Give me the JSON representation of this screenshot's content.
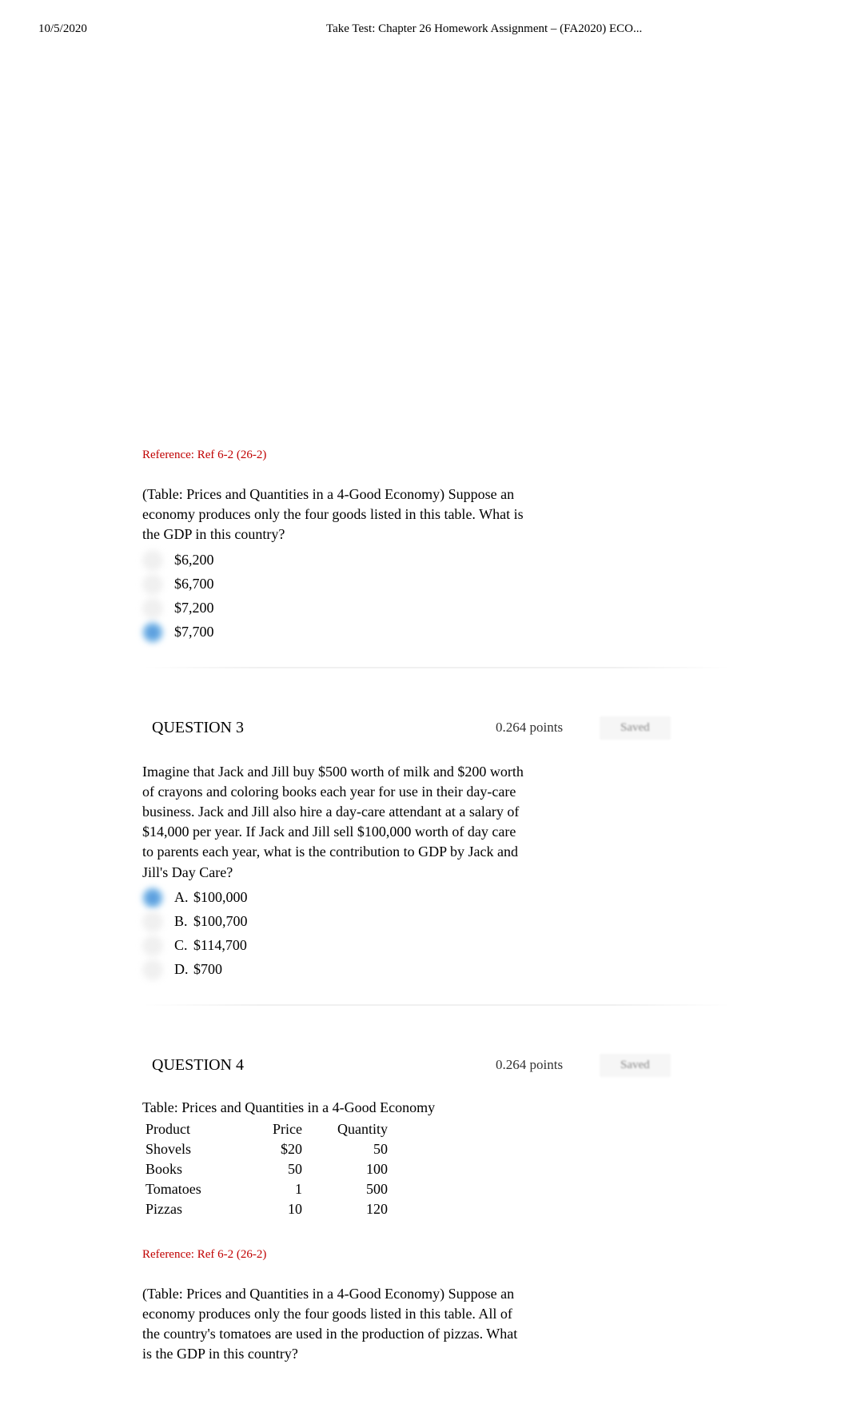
{
  "header": {
    "date": "10/5/2020",
    "title": "Take Test: Chapter 26 Homework Assignment – (FA2020) ECO..."
  },
  "question2_partial": {
    "reference": "Reference: Ref 6-2 (26-2)",
    "text": "(Table: Prices and Quantities in a 4-Good Economy) Suppose an economy produces only the four goods listed in this table. What is the GDP in this country?",
    "options": [
      {
        "label": "$6,200",
        "selected": false
      },
      {
        "label": "$6,700",
        "selected": false
      },
      {
        "label": "$7,200",
        "selected": false
      },
      {
        "label": "$7,700",
        "selected": true
      }
    ]
  },
  "question3": {
    "title": "QUESTION 3",
    "points": "0.264 points",
    "saved": "Saved",
    "text": "Imagine that Jack and Jill buy $500 worth of milk and $200 worth of crayons and coloring books each year for use in their day-care business. Jack and Jill also hire a day-care attendant at a salary of $14,000 per year. If Jack and Jill sell $100,000 worth of day care to parents each year, what is the contribution to GDP by Jack and Jill's Day Care?",
    "options": [
      {
        "letter": "A.",
        "label": "$100,000",
        "selected": true
      },
      {
        "letter": "B.",
        "label": "$100,700",
        "selected": false
      },
      {
        "letter": "C.",
        "label": "$114,700",
        "selected": false
      },
      {
        "letter": "D.",
        "label": "$700",
        "selected": false
      }
    ]
  },
  "question4": {
    "title": "QUESTION 4",
    "points": "0.264 points",
    "saved": "Saved",
    "table_title": "Table: Prices and Quantities in a 4-Good Economy",
    "table": {
      "headers": [
        "Product",
        "Price",
        "Quantity"
      ],
      "rows": [
        {
          "product": "Shovels",
          "price": "$20",
          "qty": "50"
        },
        {
          "product": "Books",
          "price": "50",
          "qty": "100"
        },
        {
          "product": "Tomatoes",
          "price": "1",
          "qty": "500"
        },
        {
          "product": "Pizzas",
          "price": "10",
          "qty": "120"
        }
      ]
    },
    "reference": "Reference: Ref 6-2 (26-2)",
    "text": "(Table: Prices and Quantities in a 4-Good Economy) Suppose an economy produces only the four goods listed in this table. All of the country's tomatoes are used in the production of pizzas. What is the GDP in this country?"
  }
}
